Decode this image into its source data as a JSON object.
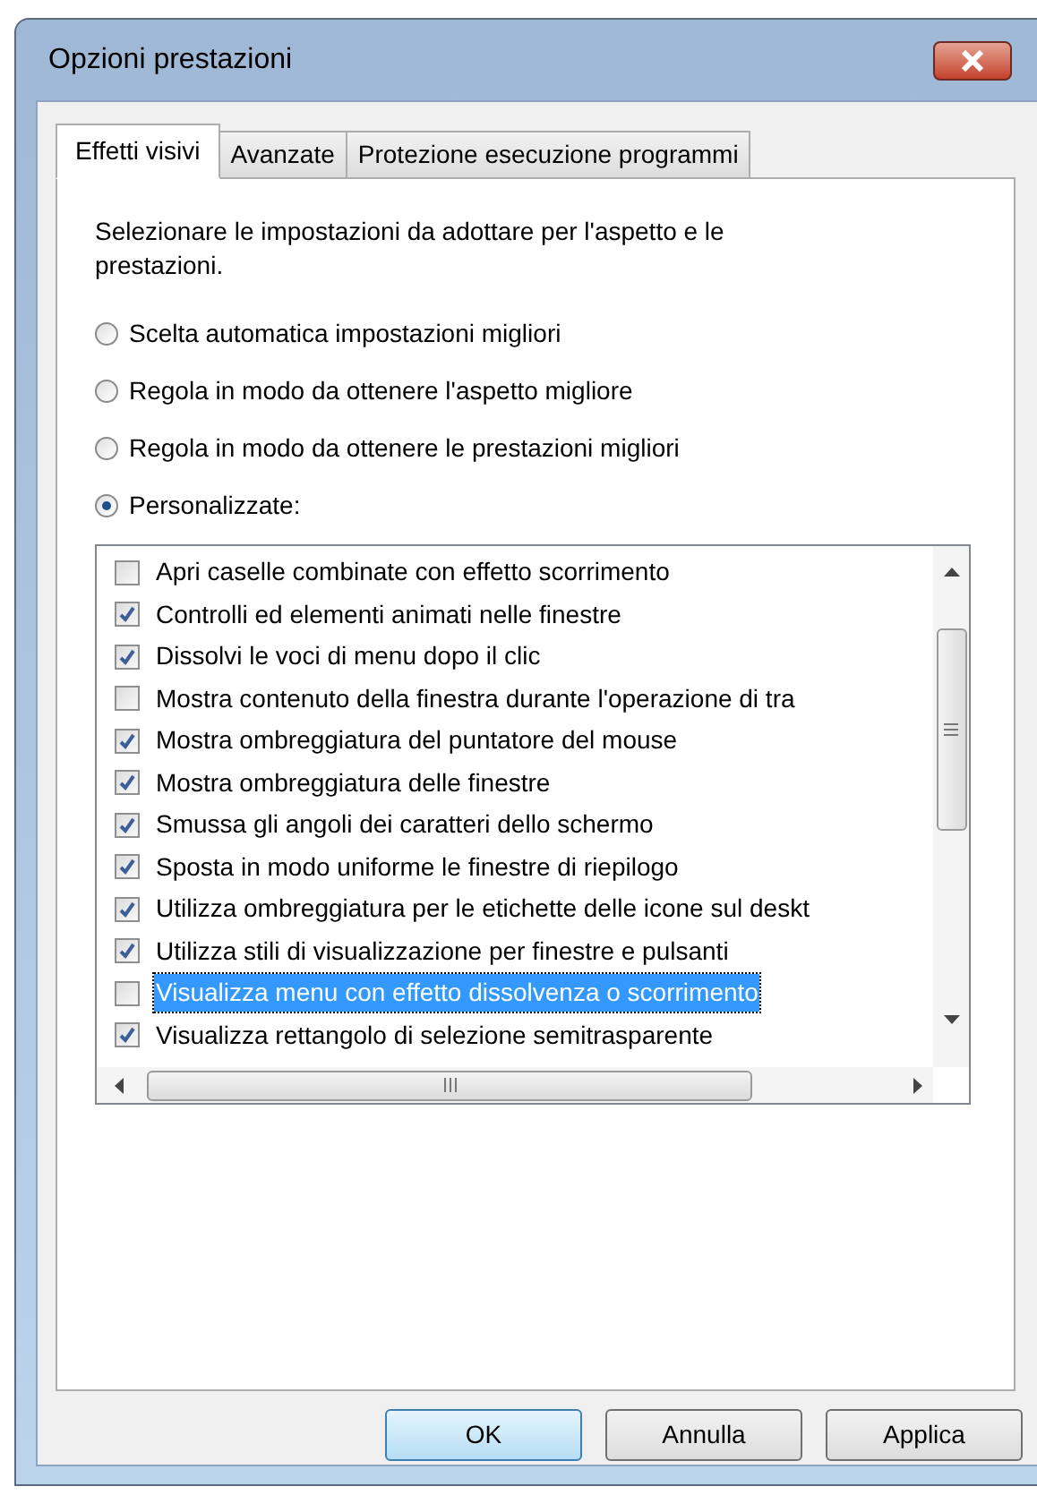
{
  "window": {
    "title": "Opzioni prestazioni"
  },
  "tabs": [
    {
      "label": "Effetti visivi",
      "selected": true
    },
    {
      "label": "Avanzate",
      "selected": false
    },
    {
      "label": "Protezione esecuzione programmi",
      "selected": false
    }
  ],
  "intro": "Selezionare le impostazioni da adottare per l'aspetto e le prestazioni.",
  "options": [
    {
      "label": "Scelta automatica impostazioni migliori",
      "selected": false
    },
    {
      "label": "Regola in modo da ottenere l'aspetto migliore",
      "selected": false
    },
    {
      "label": "Regola in modo da ottenere le prestazioni migliori",
      "selected": false
    },
    {
      "label": "Personalizzate:",
      "selected": true
    }
  ],
  "effects": [
    {
      "label": "Apri caselle combinate con effetto scorrimento",
      "checked": false,
      "selected": false
    },
    {
      "label": "Controlli ed elementi animati nelle finestre",
      "checked": true,
      "selected": false
    },
    {
      "label": "Dissolvi le voci di menu dopo il clic",
      "checked": true,
      "selected": false
    },
    {
      "label": "Mostra contenuto della finestra durante l'operazione di tra",
      "checked": false,
      "selected": false
    },
    {
      "label": "Mostra ombreggiatura del puntatore del mouse",
      "checked": true,
      "selected": false
    },
    {
      "label": "Mostra ombreggiatura delle finestre",
      "checked": true,
      "selected": false
    },
    {
      "label": "Smussa gli angoli dei caratteri dello schermo",
      "checked": true,
      "selected": false
    },
    {
      "label": "Sposta in modo uniforme le finestre di riepilogo",
      "checked": true,
      "selected": false
    },
    {
      "label": "Utilizza ombreggiatura per le etichette delle icone sul deskt",
      "checked": true,
      "selected": false
    },
    {
      "label": "Utilizza stili di visualizzazione per finestre e pulsanti",
      "checked": true,
      "selected": false
    },
    {
      "label": "Visualizza menu con effetto dissolvenza o scorrimento",
      "checked": false,
      "selected": true
    },
    {
      "label": "Visualizza rettangolo di selezione semitrasparente",
      "checked": true,
      "selected": false
    }
  ],
  "buttons": [
    {
      "label": "OK",
      "kind": "default"
    },
    {
      "label": "Annulla",
      "kind": "normal"
    },
    {
      "label": "Applica",
      "kind": "normal"
    }
  ]
}
